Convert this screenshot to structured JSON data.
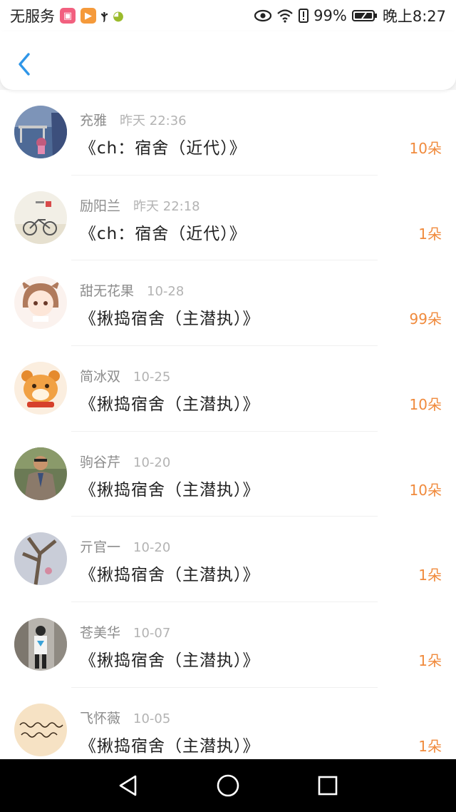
{
  "status": {
    "carrier": "无服务",
    "battery": "99%",
    "time": "晚上8:27",
    "app_icons": [
      "shopping-icon",
      "video-icon",
      "ctrip-icon",
      "bulb-icon"
    ],
    "right_icons": [
      "eye-icon",
      "wifi-icon",
      "alert-icon",
      "battery-icon"
    ]
  },
  "header": {
    "back_icon": "chevron-left-icon"
  },
  "gifts": [
    {
      "name": "充雅",
      "time": "昨天 22:36",
      "title": "《ch：宿舍（近代）》",
      "amount": "10朵",
      "avatar": "avatar-bridge-photo"
    },
    {
      "name": "励阳兰",
      "time": "昨天 22:18",
      "title": "《ch：宿舍（近代）》",
      "amount": "1朵",
      "avatar": "avatar-bicycle-illustration"
    },
    {
      "name": "甜无花果",
      "time": "10-28",
      "title": "《揪捣宿舍（主潜执）》",
      "amount": "99朵",
      "avatar": "avatar-anime-girl"
    },
    {
      "name": "简冰双",
      "time": "10-25",
      "title": "《揪捣宿舍（主潜执）》",
      "amount": "10朵",
      "avatar": "avatar-tiger-cartoon"
    },
    {
      "name": "驹谷芹",
      "time": "10-20",
      "title": "《揪捣宿舍（主潜执）》",
      "amount": "10朵",
      "avatar": "avatar-man-suit"
    },
    {
      "name": "亓官一",
      "time": "10-20",
      "title": "《揪捣宿舍（主潜执）》",
      "amount": "1朵",
      "avatar": "avatar-tree-sky"
    },
    {
      "name": "苍美华",
      "time": "10-07",
      "title": "《揪捣宿舍（主潜执）》",
      "amount": "1朵",
      "avatar": "avatar-person-street"
    },
    {
      "name": "飞怀薇",
      "time": "10-05",
      "title": "《揪捣宿舍（主潜执）》",
      "amount": "1朵",
      "avatar": "avatar-handwriting"
    }
  ],
  "nav": [
    "back-triangle-icon",
    "home-circle-icon",
    "recents-square-icon"
  ],
  "colors": {
    "accent": "#f08a3c",
    "back_blue": "#2f96e8",
    "name_gray": "#8c8c8c",
    "time_gray": "#b3b3b3"
  }
}
